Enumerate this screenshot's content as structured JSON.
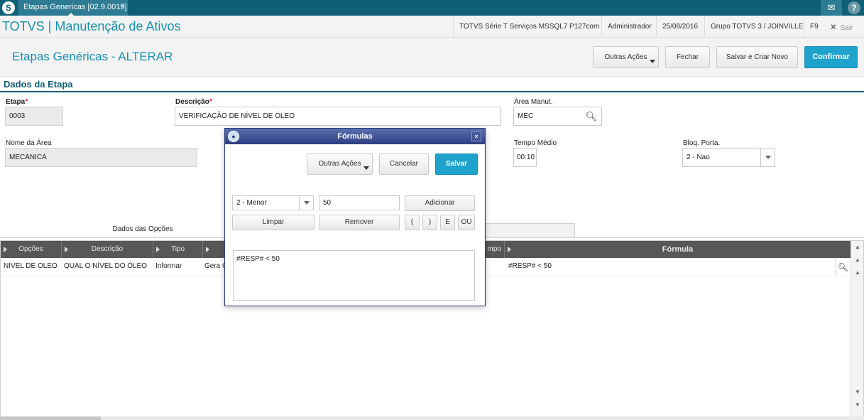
{
  "topbar": {
    "logo_glyph": "S",
    "tab_label": "Etapas Genericas [02.9.0019]",
    "tab_close": "×",
    "mail_glyph": "✉",
    "help_glyph": "?"
  },
  "brandbar": {
    "brand": "TOTVS | Manutenção de Ativos",
    "environment": "TOTVS Série T Serviços MSSQL7 P127com",
    "user": "Administrador",
    "date": "25/08/2016",
    "company": "Grupo TOTVS 3 / JOINVILLE",
    "shortcut": "F9",
    "exit_icon": "×",
    "exit_label": "Sair"
  },
  "header": {
    "title": "Etapas Genéricas - ALTERAR",
    "actions": {
      "more": "Outras Ações",
      "close": "Fechar",
      "save_new": "Salvar e Criar Novo",
      "confirm": "Confirmar"
    }
  },
  "section": {
    "title": "Dados da Etapa"
  },
  "form": {
    "etapa_label": "Etapa",
    "etapa_value": "0003",
    "descricao_label": "Descrição",
    "descricao_value": "VERIFICAÇÃO DE NÍVEL DE ÓLEO",
    "area_label": "Área Manut.",
    "area_value": "MEC",
    "nome_area_label": "Nome da Área",
    "nome_area_value": "MECANICA",
    "tempo_label": "Tempo Médio",
    "tempo_value": "00:10",
    "bloq_label": "Bloq. Porta.",
    "bloq_value": "2 - Nao",
    "required_mark": "*"
  },
  "tabs": {
    "active": "Dados das Opções"
  },
  "grid": {
    "columns": [
      "Opções",
      "Descrição",
      "Tipo",
      "",
      "mpo",
      "Fórmula"
    ],
    "row": {
      "opcoes": "NÍVEL DE OLEO",
      "descricao": "QUAL O NÍVEL DO ÓLEO",
      "tipo": "Informar",
      "gera": "Gera O",
      "formula": "#RESP#  < 50"
    }
  },
  "modal": {
    "title": "Fórmulas",
    "close": "×",
    "more": "Outras Ações",
    "cancel": "Cancelar",
    "save": "Salvar",
    "operator_value": "2 - Menor",
    "value_input": "50",
    "add": "Adicionar",
    "clear": "Limpar",
    "remove": "Remover",
    "open_paren": "(",
    "close_paren": ")",
    "and": "E",
    "or": "OU",
    "formula_text": "#RESP#  < 50"
  }
}
